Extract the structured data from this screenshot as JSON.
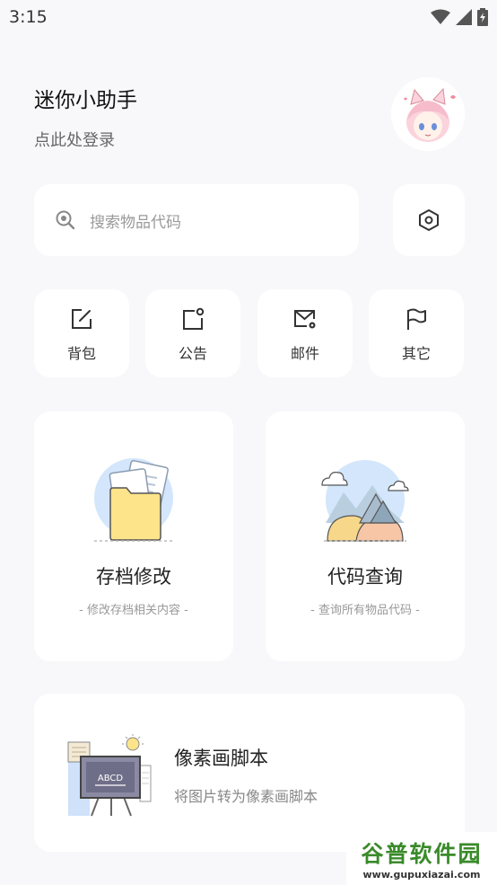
{
  "status_bar": {
    "time": "3:15"
  },
  "header": {
    "title": "迷你小助手",
    "login_hint": "点此处登录"
  },
  "search": {
    "placeholder": "搜索物品代码"
  },
  "quick_actions": [
    {
      "label": "背包",
      "icon": "edit-icon"
    },
    {
      "label": "公告",
      "icon": "notice-icon"
    },
    {
      "label": "邮件",
      "icon": "mail-settings-icon"
    },
    {
      "label": "其它",
      "icon": "flag-icon"
    }
  ],
  "features": [
    {
      "title": "存档修改",
      "subtitle": "- 修改存档相关内容 -"
    },
    {
      "title": "代码查询",
      "subtitle": "- 查询所有物品代码 -"
    }
  ],
  "pixel_script": {
    "title": "像素画脚本",
    "subtitle": "将图片转为像素画脚本",
    "board_text": "ABCD"
  },
  "watermark": {
    "name": "谷普软件园",
    "url": "www.gupuxiazai.com"
  },
  "colors": {
    "background": "#f8f8fa",
    "card": "#ffffff",
    "watermark_green": "#3a8a2a"
  }
}
